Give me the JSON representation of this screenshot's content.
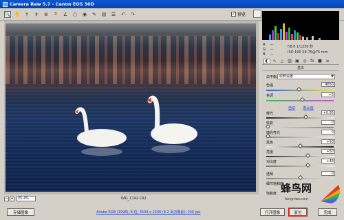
{
  "window": {
    "title": "Camera Raw 5.7 - Canon EOS 30D"
  },
  "toolbar": {
    "tools": [
      "zoom-tool-icon",
      "hand-tool-icon",
      "white-balance-tool-icon",
      "color-sampler-icon",
      "targeted-adjust-icon",
      "crop-tool-icon",
      "straighten-tool-icon",
      "spot-removal-icon",
      "red-eye-icon",
      "adjustment-brush-icon",
      "graduated-filter-icon",
      "preferences-icon",
      "rotate-left-icon",
      "rotate-right-icon"
    ],
    "preview_label": "预览",
    "preview_checked": true
  },
  "photo": {
    "filename": "IMG_1742.CR2"
  },
  "zoom": {
    "value": "25.4%"
  },
  "exif": {
    "r_label": "R:",
    "g_label": "G:",
    "b_label": "B:",
    "r_value": "---",
    "g_value": "---",
    "b_value": "---",
    "aperture_shutter": "f/8.0  1/1250 秒",
    "iso_focal": "ISO 100  28-75@75 mm"
  },
  "panel": {
    "title": "基本",
    "white_balance_label": "白平衡:",
    "white_balance_value": "原照设置",
    "temp_label": "色温",
    "temp_value": "4650",
    "temp_pos": 0.48,
    "tint_label": "色调",
    "tint_value": "+5",
    "tint_pos": 0.53,
    "auto_link": "自动",
    "default_link": "默认值",
    "exposure_label": "曝光",
    "exposure_value": "+0.65",
    "exposure_pos": 0.58,
    "recovery_label": "恢复",
    "recovery_value": "0",
    "recovery_pos": 0.0,
    "fill_light_label": "填充亮光",
    "fill_light_value": "0",
    "fill_light_pos": 0.0,
    "blacks_label": "黑色",
    "blacks_value": "+50",
    "blacks_pos": 0.5,
    "brightness_label": "亮度",
    "brightness_value": "+50",
    "brightness_pos": 0.62,
    "contrast_label": "对比度",
    "contrast_value": "+48",
    "contrast_pos": 0.62,
    "clarity_label": "透明",
    "clarity_value": "0",
    "clarity_pos": 0.5,
    "vibrance_label": "细节饱和度",
    "saturation_label": "饱和度"
  },
  "bottom": {
    "save_label": "存储图像",
    "info_text": "Adobe RGB (1998); 8 位; 3504 x 2336 (8.2 百万像素); 240 ppi",
    "open_label": "打开图像",
    "reset_label": "复位",
    "done_label": "完成"
  },
  "watermark": {
    "text": "蜂鸟网",
    "sub": "fengniao.com"
  },
  "colors": {
    "titlebar": "#0a58d6",
    "panel_bg": "#d4d0c8",
    "highlight": "#e01010",
    "link": "#1a3fd0"
  }
}
